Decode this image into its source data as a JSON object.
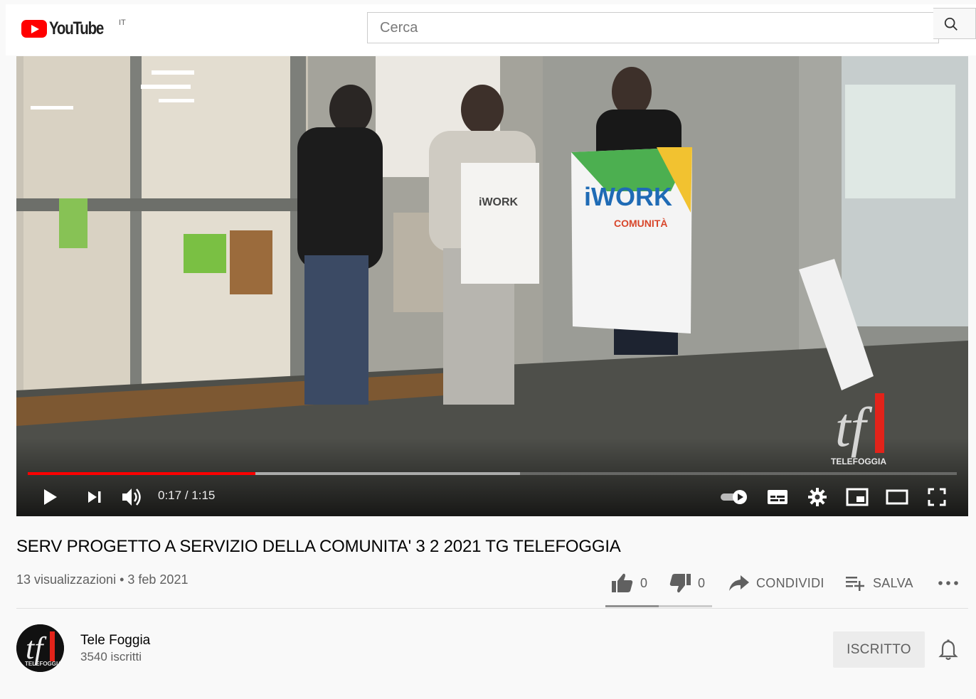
{
  "masthead": {
    "logo_text": "YouTube",
    "country_code": "IT",
    "search_placeholder": "Cerca"
  },
  "player": {
    "time_current": "0:17",
    "time_separator": " / ",
    "time_total": "1:15",
    "progress_played": 0.245,
    "buffered": 0.53,
    "watermark_text": "TELEFOGGIA",
    "video_sign_text": "iWORK",
    "video_sign_subtext": "COMUNITÀ"
  },
  "video": {
    "title": "SERV PROGETTO A SERVIZIO DELLA COMUNITA' 3 2 2021 TG TELEFOGGIA",
    "views": "13 visualizzazioni",
    "meta_separator": " • ",
    "date": "3 feb 2021",
    "likes": "0",
    "dislikes": "0",
    "share_label": "CONDIVIDI",
    "save_label": "SALVA",
    "sentiment_ratio": 0.5
  },
  "channel": {
    "name": "Tele Foggia",
    "subscribers": "3540 iscritti",
    "subscribe_label": "ISCRITTO",
    "avatar_text": "TELEFOGGIA"
  },
  "colors": {
    "brand_red": "#ff0000",
    "progress_red": "#ff0000",
    "text_primary": "#030303",
    "text_secondary": "#606060"
  }
}
